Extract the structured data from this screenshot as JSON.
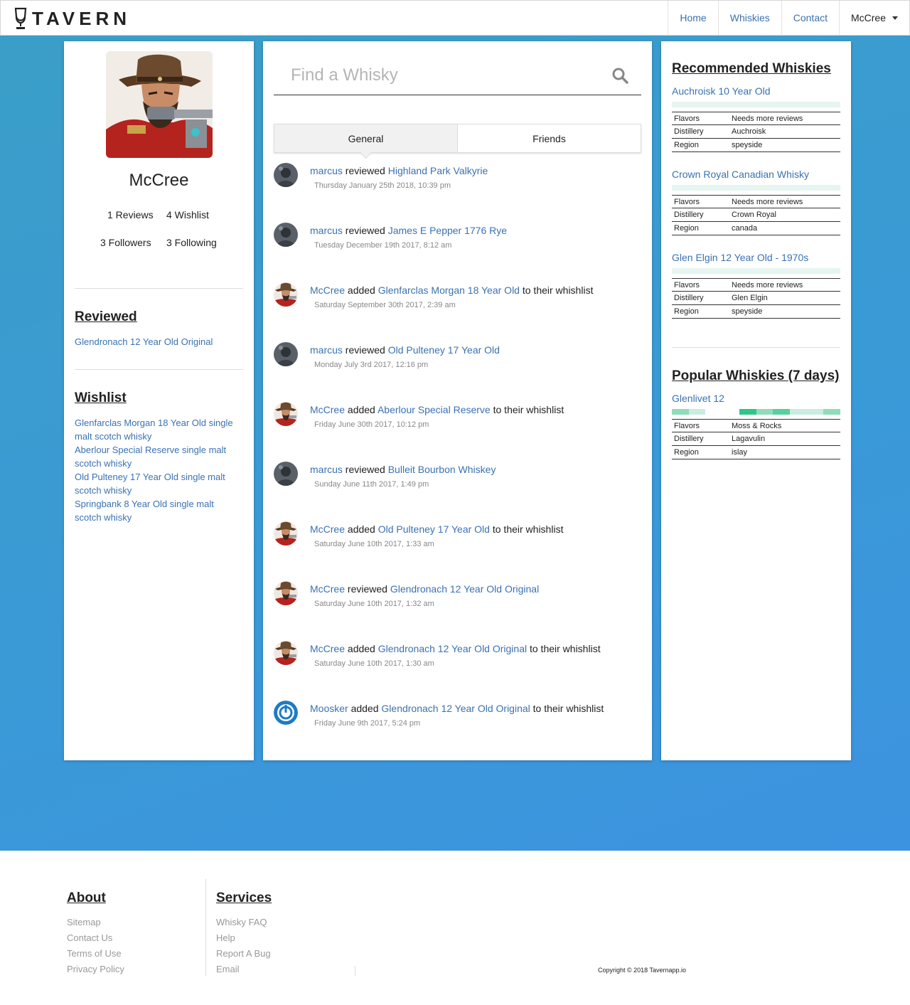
{
  "brand": {
    "name": "TAVERN"
  },
  "nav": {
    "home": "Home",
    "whiskies": "Whiskies",
    "contact": "Contact",
    "user": "McCree"
  },
  "profile": {
    "name": "McCree",
    "reviews": "1 Reviews",
    "wishlist": "4 Wishlist",
    "followers": "3 Followers",
    "following": "3 Following"
  },
  "reviewed": {
    "title": "Reviewed",
    "items": [
      "Glendronach 12 Year Old Original"
    ]
  },
  "wishlist": {
    "title": "Wishlist",
    "items": [
      "Glenfarclas Morgan 18 Year Old single malt scotch whisky",
      "Aberlour Special Reserve single malt scotch whisky",
      "Old Pulteney 17 Year Old single malt scotch whisky",
      "Springbank 8 Year Old single malt scotch whisky"
    ]
  },
  "search": {
    "placeholder": "Find a Whisky"
  },
  "tabs": {
    "general": "General",
    "friends": "Friends"
  },
  "feed": [
    {
      "user": "marcus",
      "action": "reviewed",
      "whisky": "Highland Park Valkyrie",
      "suffix": "",
      "time": "Thursday January 25th 2018, 10:39 pm",
      "avatar": "marcus"
    },
    {
      "user": "marcus",
      "action": "reviewed",
      "whisky": "James E Pepper 1776 Rye",
      "suffix": "",
      "time": "Tuesday December 19th 2017, 8:12 am",
      "avatar": "marcus"
    },
    {
      "user": "McCree",
      "action": "added",
      "whisky": "Glenfarclas Morgan 18 Year Old",
      "suffix": "to their whishlist",
      "time": "Saturday September 30th 2017, 2:39 am",
      "avatar": "mccree"
    },
    {
      "user": "marcus",
      "action": "reviewed",
      "whisky": "Old Pulteney 17 Year Old",
      "suffix": "",
      "time": "Monday July 3rd 2017, 12:16 pm",
      "avatar": "marcus"
    },
    {
      "user": "McCree",
      "action": "added",
      "whisky": "Aberlour Special Reserve",
      "suffix": "to their whishlist",
      "time": "Friday June 30th 2017, 10:12 pm",
      "avatar": "mccree"
    },
    {
      "user": "marcus",
      "action": "reviewed",
      "whisky": "Bulleit Bourbon Whiskey",
      "suffix": "",
      "time": "Sunday June 11th 2017, 1:49 pm",
      "avatar": "marcus"
    },
    {
      "user": "McCree",
      "action": "added",
      "whisky": "Old Pulteney 17 Year Old",
      "suffix": "to their whishlist",
      "time": "Saturday June 10th 2017, 1:33 am",
      "avatar": "mccree"
    },
    {
      "user": "McCree",
      "action": "reviewed",
      "whisky": "Glendronach 12 Year Old Original",
      "suffix": "",
      "time": "Saturday June 10th 2017, 1:32 am",
      "avatar": "mccree"
    },
    {
      "user": "McCree",
      "action": "added",
      "whisky": "Glendronach 12 Year Old Original",
      "suffix": "to their whishlist",
      "time": "Saturday June 10th 2017, 1:30 am",
      "avatar": "mccree"
    },
    {
      "user": "Moosker",
      "action": "added",
      "whisky": "Glendronach 12 Year Old Original",
      "suffix": "to their whishlist",
      "time": "Friday June 9th 2017, 5:24 pm",
      "avatar": "moosker"
    }
  ],
  "recommended": {
    "title": "Recommended Whiskies",
    "items": [
      {
        "name": "Auchroisk 10 Year Old",
        "flavors": "Needs more reviews",
        "distillery": "Auchroisk",
        "region": "speyside"
      },
      {
        "name": "Crown Royal Canadian Whisky",
        "flavors": "Needs more reviews",
        "distillery": "Crown Royal",
        "region": "canada"
      },
      {
        "name": "Glen Elgin 12 Year Old - 1970s",
        "flavors": "Needs more reviews",
        "distillery": "Glen Elgin",
        "region": "speyside"
      }
    ]
  },
  "popular": {
    "title": "Popular Whiskies (7 days)",
    "items": [
      {
        "name": "Glenlivet 12",
        "flavors": "Moss & Rocks",
        "distillery": "Lagavulin",
        "region": "islay"
      }
    ],
    "flavor_colors": [
      "#8fdcbd",
      "#c9ede0",
      "#ffffff",
      "#ffffff",
      "#2fc48a",
      "#8fdcbd",
      "#58cfa0",
      "#c9ede0",
      "#c9ede0",
      "#8fdcbd"
    ]
  },
  "labels": {
    "flavors": "Flavors",
    "distillery": "Distillery",
    "region": "Region"
  },
  "footer": {
    "about_title": "About",
    "about_links": [
      "Sitemap",
      "Contact Us",
      "Terms of Use",
      "Privacy Policy"
    ],
    "services_title": "Services",
    "services_links": [
      "Whisky FAQ",
      "Help",
      "Report A Bug",
      "Email"
    ],
    "copyright": "Copyright © 2018 Tavernapp.io"
  },
  "colors": {
    "link": "#3a72b3",
    "accent": "#3a9ad6"
  }
}
